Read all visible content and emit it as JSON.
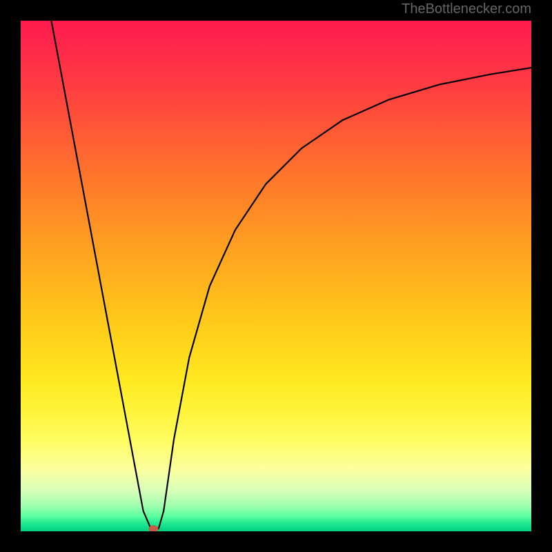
{
  "watermark": "TheBottlenecker.com",
  "chart_data": {
    "type": "line",
    "title": "",
    "xlabel": "",
    "ylabel": "",
    "xlim": [
      0,
      100
    ],
    "ylim": [
      0,
      100
    ],
    "series": [
      {
        "name": "curve",
        "x": [
          6,
          24,
          25.5,
          27,
          28,
          30,
          33,
          37,
          42,
          48,
          55,
          63,
          72,
          82,
          92,
          100
        ],
        "y": [
          100,
          4,
          0.5,
          0.5,
          4,
          18,
          34,
          48,
          59,
          68,
          75,
          80.5,
          84.5,
          87.5,
          89.5,
          90.8
        ]
      }
    ],
    "marker": {
      "x": 26,
      "y": 0.5
    },
    "gradient_colors": {
      "top": "#ff1a4d",
      "mid_upper": "#ff9922",
      "mid": "#ffe820",
      "mid_lower": "#fbffa0",
      "bottom": "#00d080"
    }
  }
}
